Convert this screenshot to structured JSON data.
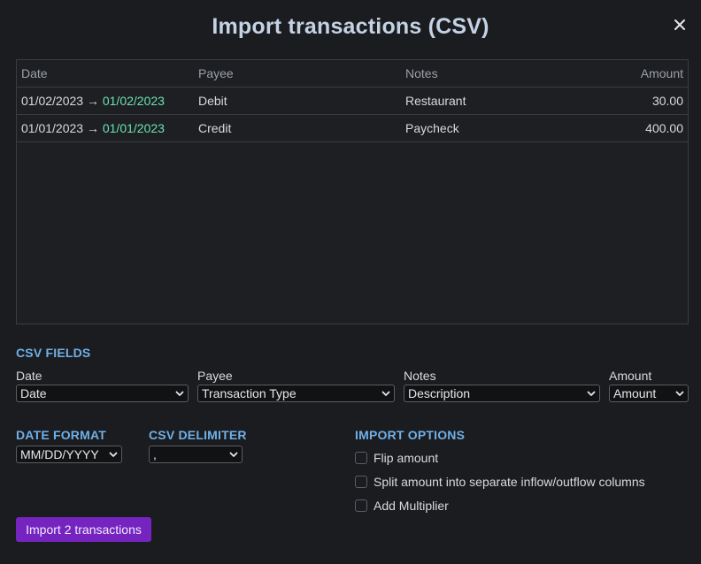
{
  "dialog": {
    "title": "Import transactions (CSV)",
    "close_icon": "close-icon"
  },
  "table": {
    "headers": {
      "date": "Date",
      "payee": "Payee",
      "notes": "Notes",
      "amount": "Amount"
    },
    "rows": [
      {
        "date_original": "01/02/2023",
        "arrow": "→",
        "date_parsed": "01/02/2023",
        "payee": "Debit",
        "notes": "Restaurant",
        "amount": "30.00"
      },
      {
        "date_original": "01/01/2023",
        "arrow": "→",
        "date_parsed": "01/01/2023",
        "payee": "Credit",
        "notes": "Paycheck",
        "amount": "400.00"
      }
    ]
  },
  "csv_fields": {
    "heading": "CSV FIELDS",
    "date": {
      "label": "Date",
      "value": "Date"
    },
    "payee": {
      "label": "Payee",
      "value": "Transaction Type"
    },
    "notes": {
      "label": "Notes",
      "value": "Description"
    },
    "amount": {
      "label": "Amount",
      "value": "Amount"
    }
  },
  "date_format": {
    "heading": "DATE FORMAT",
    "value": "MM/DD/YYYY"
  },
  "csv_delimiter": {
    "heading": "CSV DELIMITER",
    "value": ","
  },
  "import_options": {
    "heading": "IMPORT OPTIONS",
    "options": [
      {
        "label": "Flip amount",
        "checked": false
      },
      {
        "label": "Split amount into separate inflow/outflow columns",
        "checked": false
      },
      {
        "label": "Add Multiplier",
        "checked": false
      }
    ]
  },
  "import_button": {
    "label": "Import 2 transactions"
  },
  "colors": {
    "accent": "#7524c0",
    "section_heading": "#6fb0e8",
    "parsed_date": "#6ce3b0",
    "title": "#c3d2e4"
  }
}
